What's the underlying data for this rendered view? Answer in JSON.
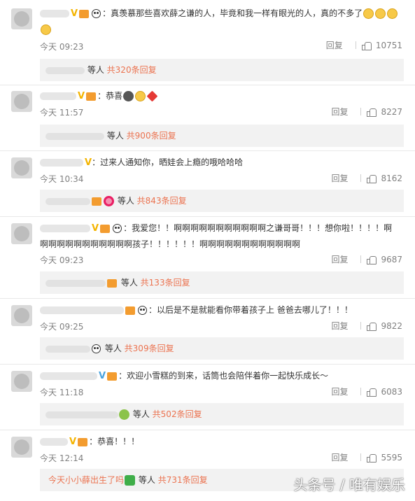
{
  "comments": [
    {
      "text_line1": "：真羡慕那些喜欢薛之谦的人，毕竟和我一样有眼光的人，真的不多了",
      "time": "今天 09:23",
      "reply_label": "回复",
      "likes": "10751",
      "reply_suffix": "等人",
      "reply_count": "共320条回复"
    },
    {
      "text_line1": "：恭喜",
      "time": "今天 11:57",
      "reply_label": "回复",
      "likes": "8227",
      "reply_suffix": "等人",
      "reply_count": "共900条回复"
    },
    {
      "text_line1": "：过来人通知你，晒娃会上瘾的哦哈哈哈",
      "time": "今天 10:34",
      "reply_label": "回复",
      "likes": "8162",
      "reply_suffix": "等人",
      "reply_count": "共843条回复"
    },
    {
      "text_line1": "：我爱您！！啊啊啊啊啊啊啊啊啊啊啊之谦哥哥！！！想你啦！！！！啊",
      "text_line2": "啊啊啊啊啊啊啊啊啊啊啊孩子！！！！！！啊啊啊啊啊啊啊啊啊啊啊啊",
      "time": "今天 09:23",
      "reply_label": "回复",
      "likes": "9687",
      "reply_suffix": "等人",
      "reply_count": "共133条回复"
    },
    {
      "text_line1": "：以后是不是就能看你带着孩子上 爸爸去哪儿了！！！",
      "time": "今天 09:25",
      "reply_label": "回复",
      "likes": "9822",
      "reply_suffix": "等人",
      "reply_count": "共309条回复"
    },
    {
      "text_line1": "：欢迎小雪糕的到来，话筒也会陪伴着你一起快乐成长～",
      "time": "今天 11:18",
      "reply_label": "回复",
      "likes": "6083",
      "reply_suffix": "等人",
      "reply_count": "共502条回复"
    },
    {
      "text_line1": "：恭喜！！！",
      "time": "今天 12:14",
      "reply_label": "回复",
      "likes": "5595",
      "reply_preview": "今天小小薛出生了吗",
      "reply_suffix": "等人",
      "reply_count": "共731条回复"
    }
  ],
  "watermark": "头条号 / 唯有娱乐",
  "colors": {
    "accent": "#eb7350",
    "vip": "#f4b400",
    "muted": "#808080",
    "reply_bg": "#f2f2f2"
  }
}
